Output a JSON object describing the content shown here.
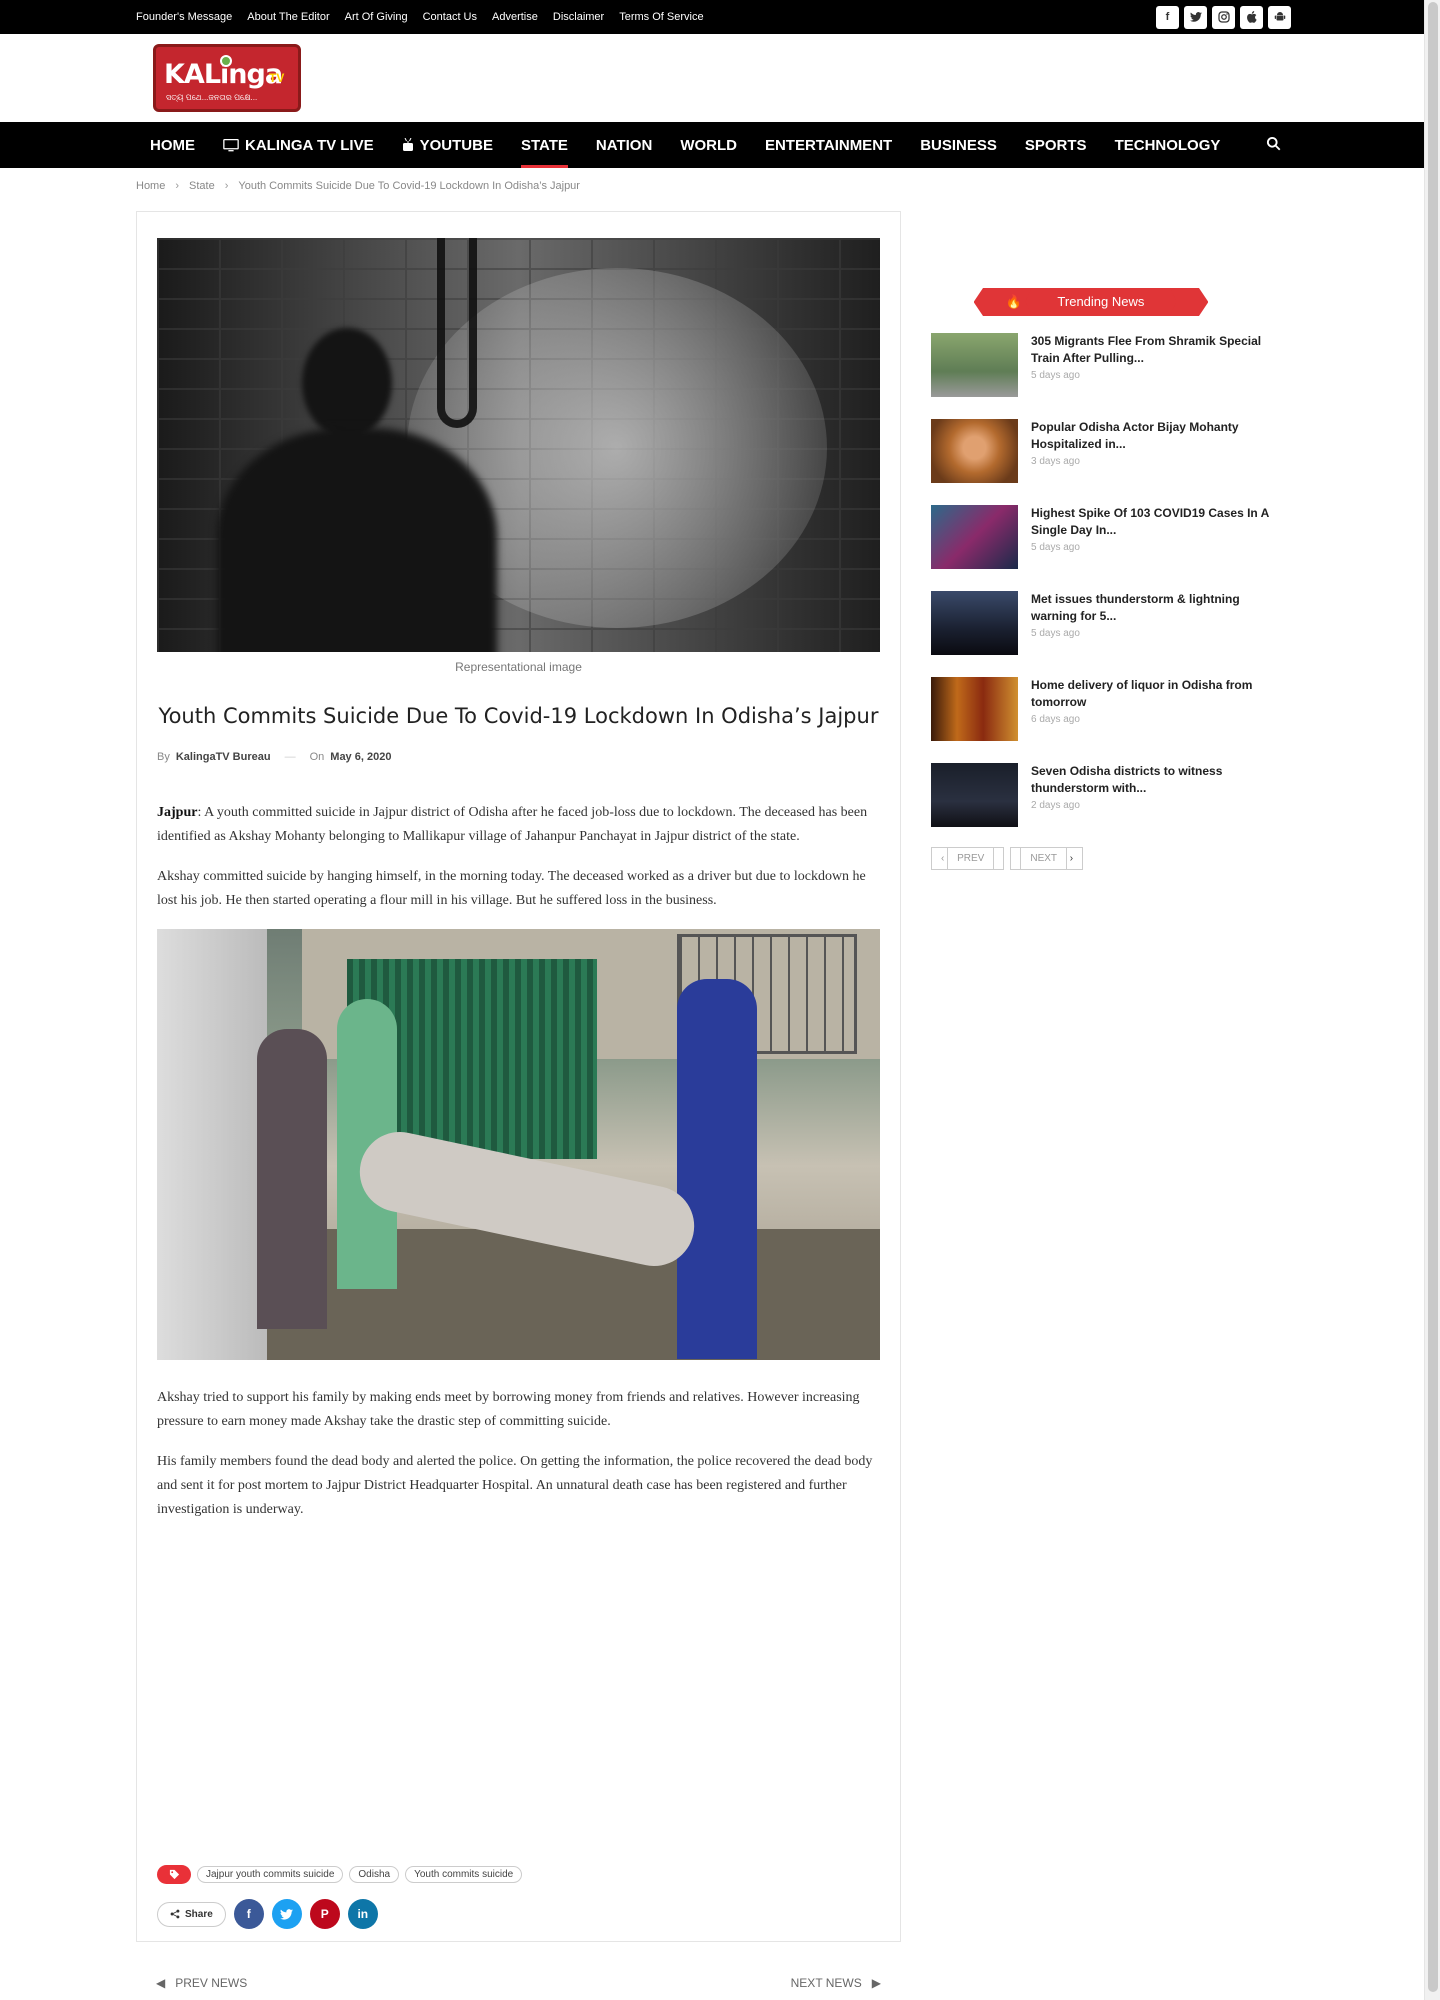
{
  "topbar": {
    "links": [
      "Founder's Message",
      "About The Editor",
      "Art Of Giving",
      "Contact Us",
      "Advertise",
      "Disclaimer",
      "Terms Of Service"
    ],
    "social_icons": [
      "facebook-icon",
      "twitter-icon",
      "instagram-icon",
      "apple-icon",
      "android-icon"
    ]
  },
  "logo": {
    "name": "KALinga",
    "suffix": "TV",
    "tagline": "ସତ୍ୟ ପଥେ...ଜନତାର ପକ୍ଷେ..."
  },
  "nav": {
    "items": [
      "HOME",
      "KALINGA TV LIVE",
      "YOUTUBE",
      "STATE",
      "NATION",
      "WORLD",
      "ENTERTAINMENT",
      "BUSINESS",
      "SPORTS",
      "TECHNOLOGY"
    ],
    "active": "STATE"
  },
  "breadcrumb": [
    "Home",
    "State",
    "Youth Commits Suicide Due To Covid-19 Lockdown In Odisha’s Jajpur"
  ],
  "article": {
    "image_caption": "Representational image",
    "title": " Youth Commits Suicide Due To Covid-19 Lockdown In Odisha’s Jajpur",
    "by_label": "By",
    "author": "KalingaTV Bureau",
    "on_label": "On",
    "date": "May 6, 2020",
    "lead_place": "Jajpur",
    "p1": ": A youth committed suicide in Jajpur district of Odisha after he faced job-loss due to lockdown.  The deceased has been identified as  Akshay Mohanty belonging to Mallikapur village of Jahanpur Panchayat in Jajpur district of the state.",
    "p2": "Akshay committed suicide by hanging himself, in the morning today. The deceased worked as a driver but due to lockdown he lost his job. He then started operating a flour mill in his village. But he suffered loss in the business.",
    "p3": "Akshay tried to support his family by making ends meet  by borrowing money from friends and relatives. However increasing pressure to earn money made Akshay take the drastic step of committing suicide.",
    "p4": "His family members found the dead body and alerted the police. On getting the information, the police recovered the dead body and sent it for post mortem to Jajpur District Headquarter Hospital. An unnatural death case has been registered and further investigation is underway.",
    "tags": [
      "Jajpur youth commits suicide",
      "Odisha",
      "Youth commits suicide"
    ],
    "share_label": "Share"
  },
  "post_nav": {
    "prev": "PREV NEWS",
    "next": "NEXT NEWS"
  },
  "sidebar": {
    "heading": "Trending News",
    "items": [
      {
        "title": "305 Migrants Flee From Shramik Special Train After Pulling...",
        "time": "5 days ago"
      },
      {
        "title": "Popular Odisha Actor Bijay Mohanty Hospitalized in...",
        "time": "3 days ago"
      },
      {
        "title": "Highest Spike Of 103 COVID19 Cases In A Single Day In...",
        "time": "5 days ago"
      },
      {
        "title": "Met issues thunderstorm & lightning warning for 5...",
        "time": "5 days ago"
      },
      {
        "title": "Home delivery of liquor in Odisha from tomorrow",
        "time": "6 days ago"
      },
      {
        "title": "Seven Odisha districts to witness thunderstorm with...",
        "time": "2 days ago"
      }
    ],
    "prev": "PREV",
    "next": "NEXT"
  },
  "colors": {
    "accent": "#e93138",
    "topbar_bg": "#000000",
    "facebook": "#3b5998",
    "twitter": "#1da1f2",
    "pinterest": "#bd081c",
    "linkedin": "#0e76a8"
  }
}
